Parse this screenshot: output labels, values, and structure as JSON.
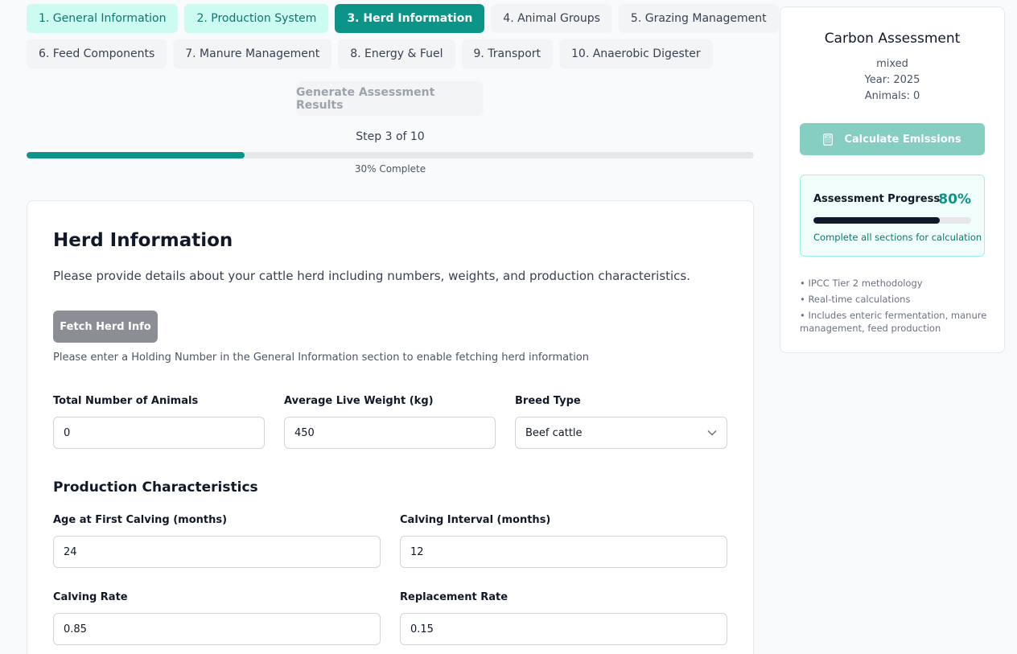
{
  "steps": [
    {
      "label": "1. General Information",
      "state": "done"
    },
    {
      "label": "2. Production System",
      "state": "done"
    },
    {
      "label": "3. Herd Information",
      "state": "active"
    },
    {
      "label": "4. Animal Groups",
      "state": "todo"
    },
    {
      "label": "5. Grazing Management",
      "state": "todo"
    },
    {
      "label": "6. Feed Components",
      "state": "todo"
    },
    {
      "label": "7. Manure Management",
      "state": "todo"
    },
    {
      "label": "8. Energy & Fuel",
      "state": "todo"
    },
    {
      "label": "9. Transport",
      "state": "todo"
    },
    {
      "label": "10. Anaerobic Digester",
      "state": "todo"
    }
  ],
  "generate_label": "Generate Assessment Results",
  "progress": {
    "step_text": "Step 3 of 10",
    "percent": 30,
    "percent_text": "30% Complete"
  },
  "form": {
    "title": "Herd Information",
    "description": "Please provide details about your cattle herd including numbers, weights, and production characteristics.",
    "fetch_label": "Fetch Herd Info",
    "fetch_hint": "Please enter a Holding Number in the General Information section to enable fetching herd information",
    "total_animals": {
      "label": "Total Number of Animals",
      "value": "0"
    },
    "avg_weight": {
      "label": "Average Live Weight (kg)",
      "value": "450"
    },
    "breed": {
      "label": "Breed Type",
      "value": "Beef cattle"
    },
    "production_title": "Production Characteristics",
    "age_first_calving": {
      "label": "Age at First Calving (months)",
      "value": "24"
    },
    "calving_interval": {
      "label": "Calving Interval (months)",
      "value": "12"
    },
    "calving_rate": {
      "label": "Calving Rate",
      "value": "0.85"
    },
    "replacement_rate": {
      "label": "Replacement Rate",
      "value": "0.15"
    }
  },
  "sidebar": {
    "title": "Carbon Assessment",
    "system": "mixed",
    "year": "Year: 2025",
    "animals": "Animals: 0",
    "calculate_label": "Calculate Emissions",
    "calculate_icon": "calculator-icon",
    "progress_title": "Assessment Progress",
    "progress_percent": 80,
    "progress_percent_text": "80%",
    "progress_note": "Complete all sections for calculation",
    "notes": [
      "• IPCC Tier 2 methodology",
      "• Real-time calculations",
      "• Includes enteric fermentation, manure management, feed production"
    ]
  },
  "colors": {
    "accent": "#0d9488",
    "done_bg": "#ccfbf1",
    "done_text": "#0f766e"
  }
}
